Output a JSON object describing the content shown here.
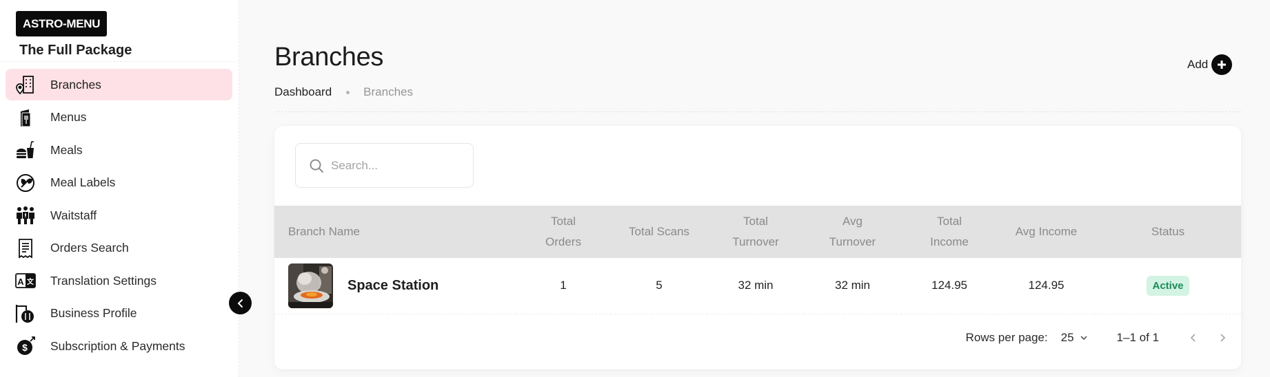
{
  "brand": {
    "logo_text": "ASTRO-MENU",
    "org_name": "The Full Package"
  },
  "sidebar": {
    "items": [
      {
        "label": "Branches",
        "icon": "branch-map-icon",
        "active": true
      },
      {
        "label": "Menus",
        "icon": "menu-book-icon"
      },
      {
        "label": "Meals",
        "icon": "fastfood-icon"
      },
      {
        "label": "Meal Labels",
        "icon": "leaf-label-icon"
      },
      {
        "label": "Waitstaff",
        "icon": "people-group-icon"
      },
      {
        "label": "Orders Search",
        "icon": "receipt-icon"
      },
      {
        "label": "Translation Settings",
        "icon": "translate-icon"
      },
      {
        "label": "Business Profile",
        "icon": "restaurant-sign-icon"
      },
      {
        "label": "Subscription & Payments",
        "icon": "dollar-coin-icon"
      }
    ]
  },
  "page": {
    "title": "Branches",
    "breadcrumb": {
      "home": "Dashboard",
      "current": "Branches"
    },
    "add_label": "Add"
  },
  "search": {
    "placeholder": "Search..."
  },
  "table": {
    "headers": {
      "name": "Branch Name",
      "orders": [
        "Total",
        "Orders"
      ],
      "scans": "Total Scans",
      "turnover": [
        "Total",
        "Turnover"
      ],
      "avg_turnover": [
        "Avg",
        "Turnover"
      ],
      "income": [
        "Total",
        "Income"
      ],
      "avg_income": "Avg Income",
      "status": "Status"
    },
    "rows": [
      {
        "name": "Space Station",
        "total_orders": "1",
        "total_scans": "5",
        "total_turnover": "32 min",
        "avg_turnover": "32 min",
        "total_income": "124.95",
        "avg_income": "124.95",
        "status": "Active"
      }
    ]
  },
  "pagination": {
    "rows_label": "Rows per page:",
    "rows_value": "25",
    "range": "1–1 of 1"
  },
  "colors": {
    "active_nav_bg": "#fde1e6",
    "status_bg": "#d3f3e3",
    "status_text": "#1c8a58",
    "header_bg": "#e2e2e2"
  }
}
